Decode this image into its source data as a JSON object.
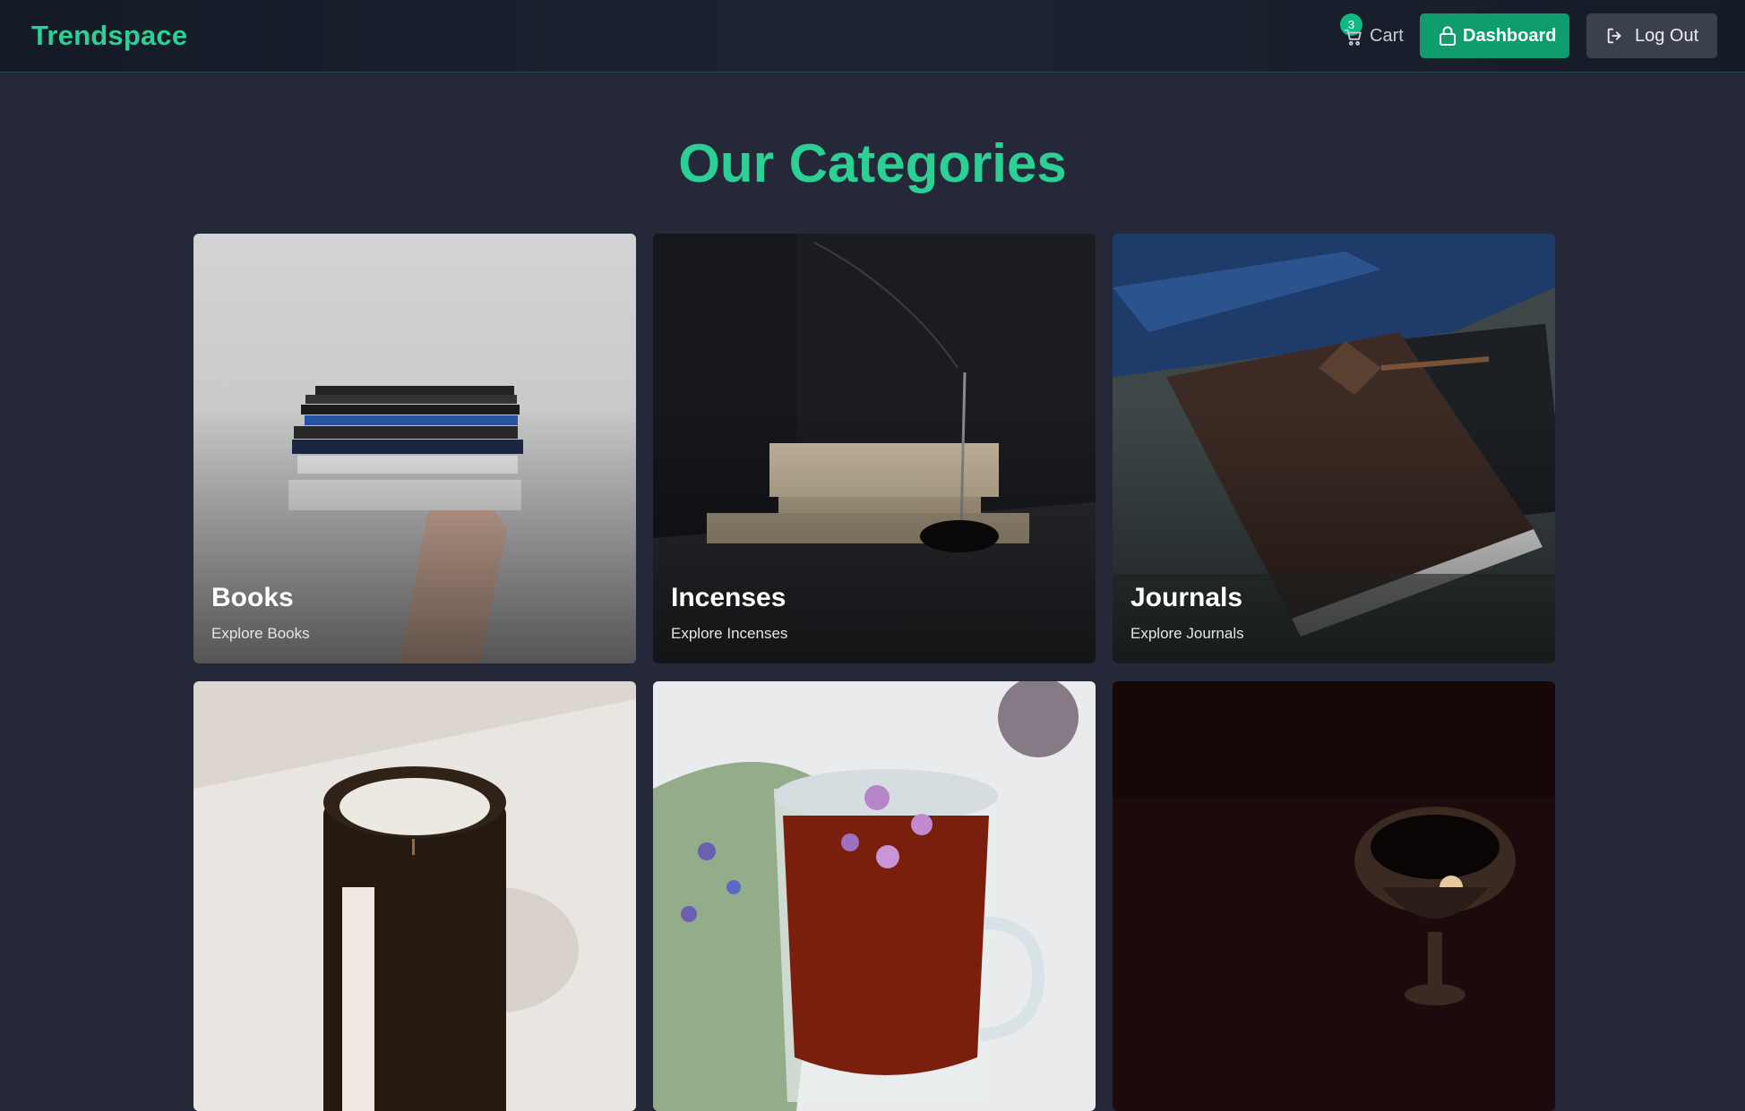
{
  "header": {
    "brand": "Trendspace",
    "cart_label": "Cart",
    "cart_count": "3",
    "dashboard_label": "Dashboard",
    "logout_label": "Log Out"
  },
  "main": {
    "title": "Our Categories",
    "categories": [
      {
        "title": "Books",
        "subtitle": "Explore Books"
      },
      {
        "title": "Incenses",
        "subtitle": "Explore Incenses"
      },
      {
        "title": "Journals",
        "subtitle": "Explore Journals"
      },
      {
        "title": "",
        "subtitle": ""
      },
      {
        "title": "",
        "subtitle": ""
      },
      {
        "title": "",
        "subtitle": ""
      }
    ]
  },
  "colors": {
    "accent": "#2ccf94",
    "dashboard_button": "#0f9d6e",
    "logout_button": "#3b404d",
    "background": "#242838"
  },
  "icons": {
    "cart": "cart-icon",
    "dashboard": "lock-icon",
    "logout": "logout-icon"
  }
}
